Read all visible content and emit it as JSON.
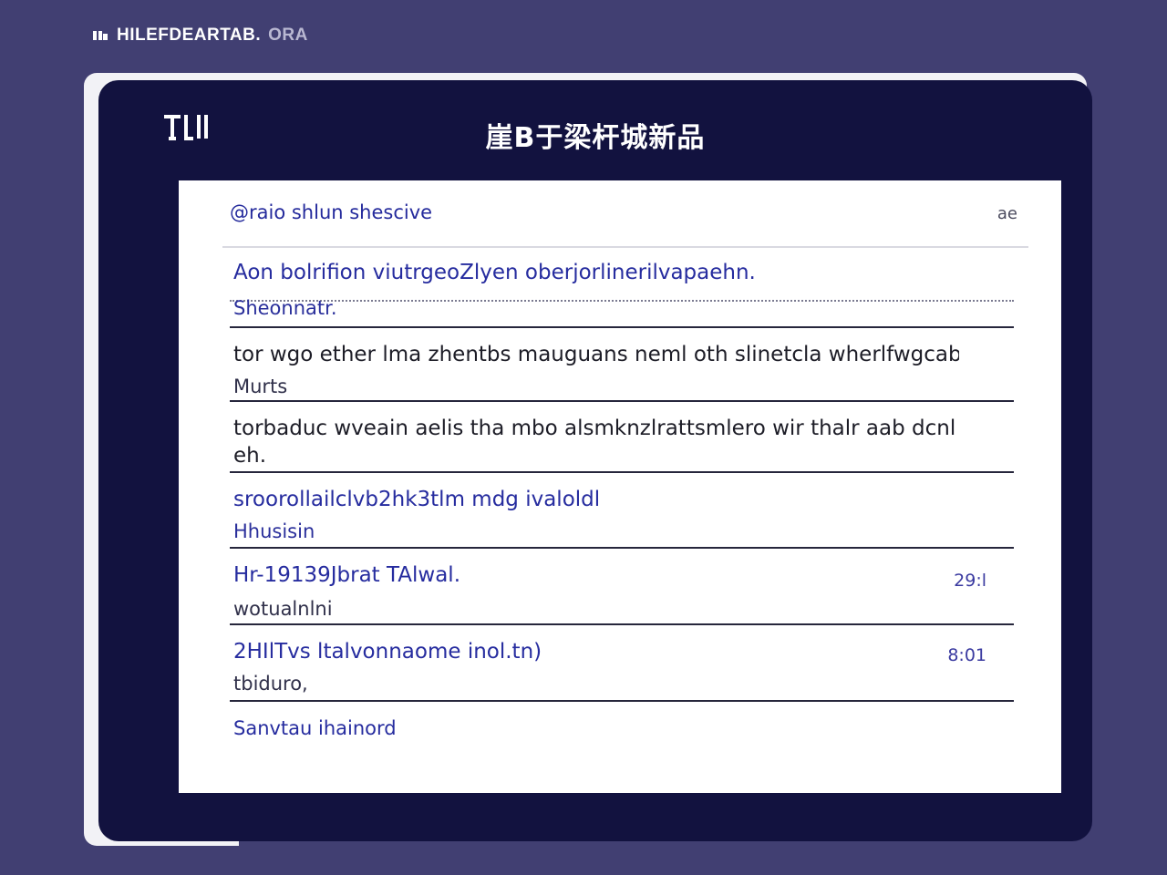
{
  "header": {
    "brand": "HILEFDEARTAB.",
    "brand_fade": "ORA"
  },
  "window": {
    "logo_text": "TIL",
    "title": "崖B于梁杆城新品"
  },
  "panel": {
    "title": "@raio shlun shescive",
    "close_label": "ae"
  },
  "list": {
    "items": [
      {
        "title": "Aon bolrifion viutrgeoZlyen oberjorlinerilvapaehn.",
        "subtitle": "Sheonnatr."
      },
      {
        "title": "tor wgo ether lma zhentbs mauguans neml oth slinetcla wherlfwgcabm",
        "subtitle": "Murts"
      },
      {
        "title": "torbaduc wveain aelis tha mbo alsmknzlrattsmlero wir thalr aab dcnl",
        "title_line2": "eh."
      },
      {
        "title": "sroorollailclvb2hk3tlm mdg ivaloldl",
        "subtitle": "Hhusisin"
      },
      {
        "title": "Hr-19139Jbrat TAlwal.",
        "subtitle": "wotualnlni",
        "meta": "29:l"
      },
      {
        "title": "2HIlTvs ltalvonnaome inol.tn)",
        "subtitle": "tbiduro,",
        "meta": "8:01"
      },
      {
        "title": "Sanvtau ihainord"
      }
    ]
  }
}
